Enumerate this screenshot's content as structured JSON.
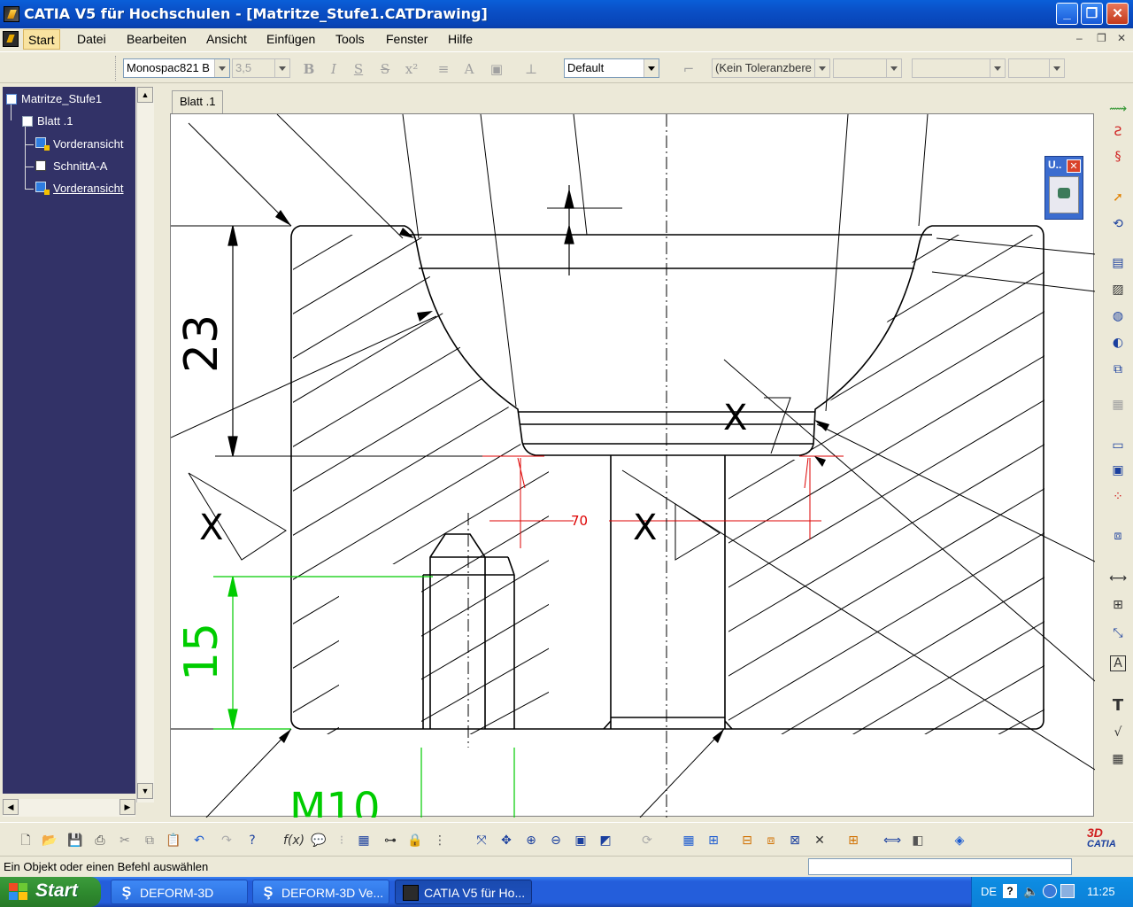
{
  "window": {
    "title": "CATIA V5 für Hochschulen - [Matritze_Stufe1.CATDrawing]",
    "min_glyph": "_",
    "max_glyph": "❐",
    "close_glyph": "✕"
  },
  "menubar": {
    "items": [
      "Start",
      "Datei",
      "Bearbeiten",
      "Ansicht",
      "Einfügen",
      "Tools",
      "Fenster",
      "Hilfe"
    ],
    "active": "Start",
    "mdi_min": "–",
    "mdi_restore": "❐",
    "mdi_close": "✕"
  },
  "format_toolbar": {
    "font_name": "Monospac821 B",
    "font_size": "3,5",
    "style_combo": "Default",
    "tolerance_combo": "(Kein Toleranzbere",
    "icons": [
      "bold-icon",
      "italic-icon",
      "underline-icon",
      "strikethrough-icon",
      "superscript-icon",
      "align-icon",
      "text-frame-icon",
      "anchor-icon",
      "clear-format-icon"
    ]
  },
  "tree": {
    "nodes": [
      {
        "label": "Matritze_Stufe1",
        "icon": "drawing-icon",
        "level": 0
      },
      {
        "label": "Blatt .1",
        "icon": "sheet-icon",
        "level": 1
      },
      {
        "label": "Vorderansicht",
        "icon": "view-icon",
        "level": 2
      },
      {
        "label": "SchnittA-A",
        "icon": "section-view-icon",
        "level": 2
      },
      {
        "label": "Vorderansicht",
        "icon": "view-icon",
        "level": 2,
        "selected": true
      }
    ]
  },
  "drawing": {
    "tab_label": "Blatt .1",
    "dim_23": "23",
    "dim_15": "15",
    "dim_70": "70",
    "thread_label": "M10",
    "weld_marks": [
      "X",
      "X",
      "X"
    ],
    "dock_title": "U..",
    "dock_close": "✕",
    "colors": {
      "line": "#000000",
      "dim_green": "#00cc00",
      "dim_red": "#dd0000"
    }
  },
  "right_toolbar": {
    "icons": [
      "select-icon",
      "sketcher-icon",
      "update-icon",
      "arrow-select-icon",
      "rotate-icon",
      "view-front-icon",
      "section-icon",
      "detail-icon",
      "clipping-icon",
      "broken-view-icon",
      "new-sheet-icon",
      "frame-icon",
      "table-icon",
      "dimension-icon",
      "chain-dim-icon",
      "tolerance-icon",
      "text-icon",
      "roughness-icon",
      "weld-icon",
      "grid-icon"
    ]
  },
  "bottom_toolbar": {
    "icons": [
      "new-icon",
      "open-icon",
      "save-icon",
      "print-icon",
      "cut-icon",
      "copy-icon",
      "paste-icon",
      "undo-icon",
      "redo-icon",
      "help-icon",
      "formula-icon",
      "comment-icon",
      "knowledge-icon",
      "table-icon",
      "tree-icon",
      "lock-icon",
      "filter-icon",
      "fit-all-icon",
      "pan-icon",
      "zoom-in-icon",
      "zoom-out-icon",
      "zoom-area-icon",
      "normal-view-icon",
      "swap-icon",
      "grid-icon",
      "snap-icon",
      "analysis-icon",
      "generate-dim-icon",
      "update-view-icon",
      "filter-generated-icon",
      "measure-icon",
      "catalog-icon"
    ],
    "logo": "CATIA"
  },
  "statusbar": {
    "text": "Ein Objekt oder einen Befehl auswählen"
  },
  "taskbar": {
    "start_label": "Start",
    "tasks": [
      {
        "label": "DEFORM-3D",
        "icon": "deform-icon"
      },
      {
        "label": "DEFORM-3D  Ve...",
        "icon": "deform-icon"
      },
      {
        "label": "CATIA V5 für Ho...",
        "icon": "catia-icon",
        "active": true
      }
    ],
    "language": "DE",
    "time": "11:25"
  }
}
